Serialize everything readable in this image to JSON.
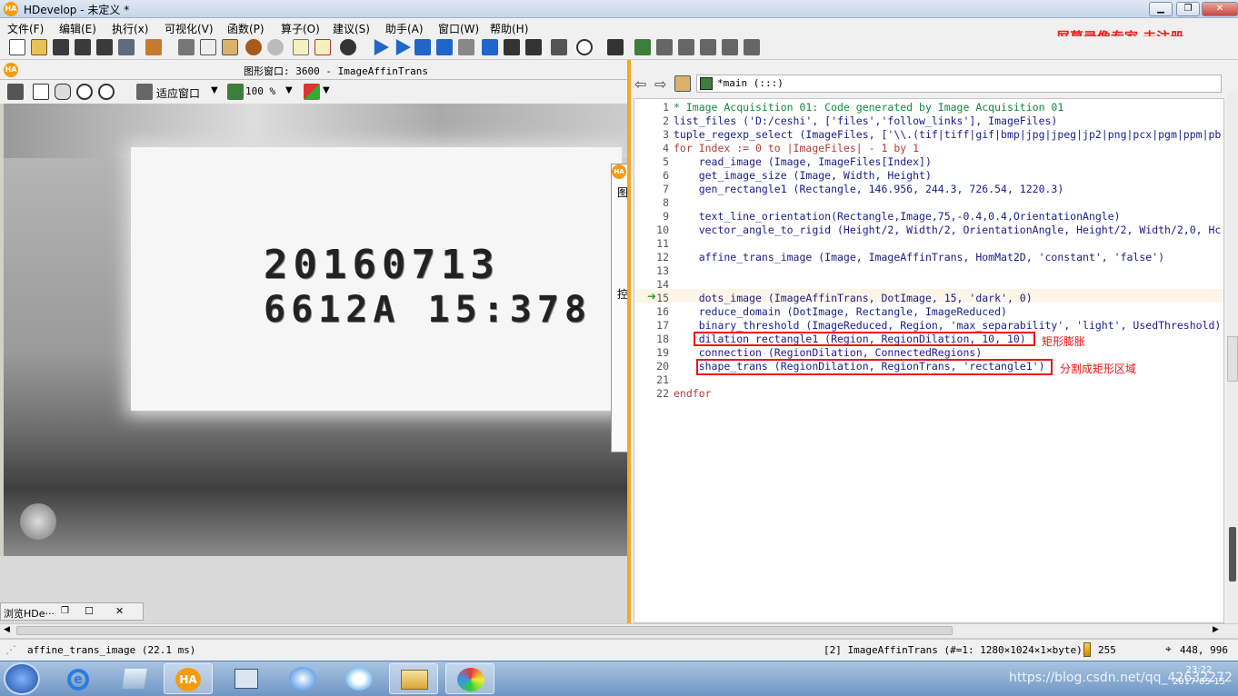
{
  "window": {
    "logo": "HA",
    "title": "HDevelop - 未定义 *",
    "buttons": {
      "minimize": "▁",
      "restore": "❐",
      "close": "✕"
    }
  },
  "menu": [
    "文件(F)",
    "编辑(E)",
    "执行(x)",
    "可视化(V)",
    "函数(P)",
    "算子(O)",
    "建议(S)",
    "助手(A)",
    "窗口(W)",
    "帮助(H)"
  ],
  "watermark": "屏幕录像专家  未注册",
  "graphics": {
    "title": "图形窗口: 3600 - ImageAffinTrans",
    "fit_label": "适应窗口",
    "zoom_value": "100 %",
    "image_line1": "20160713",
    "image_line2": "6612A  15:378",
    "side_panel_char": "图",
    "side_panel_char2": "控"
  },
  "browse_tab": {
    "label": "浏览HDe···",
    "close": "✕"
  },
  "editor": {
    "procedure": "*main (:::)",
    "lines": [
      {
        "n": "1",
        "text": "* Image Acquisition 01: Code generated by Image Acquisition 01",
        "cls": "cmt"
      },
      {
        "n": "2",
        "text": "list_files ('D:/ceshi', ['files','follow_links'], ImageFiles)",
        "cls": ""
      },
      {
        "n": "3",
        "text": "tuple_regexp_select (ImageFiles, ['\\\\.(tif|tiff|gif|bmp|jpg|jpeg|jp2|png|pcx|pgm|ppm|pb",
        "cls": ""
      },
      {
        "n": "4",
        "text": "for Index := 0 to |ImageFiles| - 1 by 1",
        "cls": "kw"
      },
      {
        "n": "5",
        "text": "    read_image (Image, ImageFiles[Index])",
        "cls": ""
      },
      {
        "n": "6",
        "text": "    get_image_size (Image, Width, Height)",
        "cls": ""
      },
      {
        "n": "7",
        "text": "    gen_rectangle1 (Rectangle, 146.956, 244.3, 726.54, 1220.3)",
        "cls": ""
      },
      {
        "n": "8",
        "text": "",
        "cls": ""
      },
      {
        "n": "9",
        "text": "    text_line_orientation(Rectangle,Image,75,-0.4,0.4,OrientationAngle)",
        "cls": ""
      },
      {
        "n": "10",
        "text": "    vector_angle_to_rigid (Height/2, Width/2, OrientationAngle, Height/2, Width/2,0, Hc",
        "cls": ""
      },
      {
        "n": "11",
        "text": "",
        "cls": ""
      },
      {
        "n": "12",
        "text": "    affine_trans_image (Image, ImageAffinTrans, HomMat2D, 'constant', 'false')",
        "cls": ""
      },
      {
        "n": "13",
        "text": "",
        "cls": ""
      },
      {
        "n": "14",
        "text": "",
        "cls": ""
      },
      {
        "n": "15",
        "text": "    dots_image (ImageAffinTrans, DotImage, 15, 'dark', 0)",
        "cls": ""
      },
      {
        "n": "16",
        "text": "    reduce_domain (DotImage, Rectangle, ImageReduced)",
        "cls": ""
      },
      {
        "n": "17",
        "text": "    binary_threshold (ImageReduced, Region, 'max_separability', 'light', UsedThreshold)",
        "cls": ""
      },
      {
        "n": "18",
        "text": "    dilation_rectangle1 (Region, RegionDilation, 10, 10)",
        "cls": ""
      },
      {
        "n": "19",
        "text": "    connection (RegionDilation, ConnectedRegions)",
        "cls": ""
      },
      {
        "n": "20",
        "text": "    shape_trans (RegionDilation, RegionTrans, 'rectangle1')",
        "cls": ""
      },
      {
        "n": "21",
        "text": "",
        "cls": ""
      },
      {
        "n": "22",
        "text": "endfor",
        "cls": "kw"
      }
    ],
    "annotations": {
      "line18": "矩形膨胀",
      "line20": "分割成矩形区域"
    }
  },
  "status": {
    "message": "affine_trans_image (22.1 ms)",
    "image_info": "[2] ImageAffinTrans (#=1: 1280×1024×1×byte)",
    "gray_value": "255",
    "coords": "448,  996"
  },
  "taskbar": {
    "blog": "https://blog.csdn.net/qq_42632272",
    "time": "23:22",
    "date": "2017-05-15",
    "items": [
      "start",
      "ie",
      "files",
      "hdevelop",
      "network",
      "messenger",
      "qq",
      "explorer",
      "paint"
    ]
  },
  "colors": {
    "accent": "#f5a623",
    "annotation": "#ee1111",
    "comment": "#0f8a3e",
    "keyword": "#b23b3b"
  }
}
